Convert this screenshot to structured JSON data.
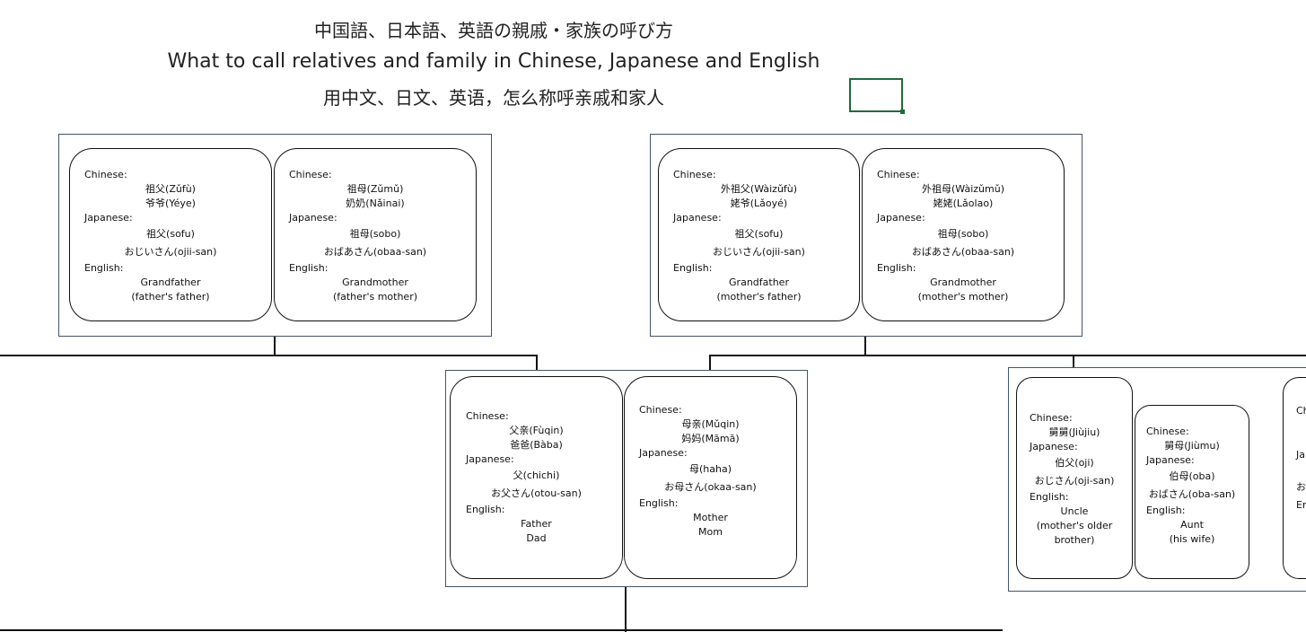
{
  "title": {
    "line1": "中国語、日本語、英語の親戚・家族の呼び方",
    "line2": "What to call relatives and family in Chinese, Japanese and English",
    "line3": "用中文、日文、英语，怎么称呼亲戚和家人"
  },
  "labels": {
    "chinese": "Chinese:",
    "japanese": "Japanese:",
    "english": "English:"
  },
  "cards": {
    "pgf": {
      "zh": [
        "祖父(Zǔfù)",
        "爷爷(Yéye)"
      ],
      "ja": [
        "祖父(sofu)",
        "おじいさん(ojii-san)"
      ],
      "en": [
        "Grandfather",
        "(father's father)"
      ]
    },
    "pgm": {
      "zh": [
        "祖母(Zǔmǔ)",
        "奶奶(Nǎinai)"
      ],
      "ja": [
        "祖母(sobo)",
        "おばあさん(obaa-san)"
      ],
      "en": [
        "Grandmother",
        "(father's mother)"
      ]
    },
    "mgf": {
      "zh": [
        "外祖父(Wàizǔfù)",
        "姥爷(Lǎoyé)"
      ],
      "ja": [
        "祖父(sofu)",
        "おじいさん(ojii-san)"
      ],
      "en": [
        "Grandfather",
        "(mother's father)"
      ]
    },
    "mgm": {
      "zh": [
        "外祖母(Wàizǔmǔ)",
        "姥姥(Lǎolao)"
      ],
      "ja": [
        "祖母(sobo)",
        "おばあさん(obaa-san)"
      ],
      "en": [
        "Grandmother",
        "(mother's mother)"
      ]
    },
    "father": {
      "zh": [
        "父亲(Fùqin)",
        "爸爸(Bàba)"
      ],
      "ja": [
        "父(chichi)",
        "お父さん(otou-san)"
      ],
      "en": [
        "Father",
        "Dad"
      ]
    },
    "mother": {
      "zh": [
        "母亲(Mǔqin)",
        "妈妈(Māmā)"
      ],
      "ja": [
        "母(haha)",
        "お母さん(okaa-san)"
      ],
      "en": [
        "Mother",
        "Mom"
      ]
    },
    "uncle": {
      "zh": [
        "舅舅(Jiùjiu)"
      ],
      "ja": [
        "伯父(oji)",
        "おじさん(oji-san)"
      ],
      "en": [
        "Uncle",
        "(mother's older",
        "brother)"
      ]
    },
    "aunt": {
      "zh": [
        "舅母(Jiùmu)"
      ],
      "ja": [
        "伯母(oba)",
        "おばさん(oba-san)"
      ],
      "en": [
        "Aunt",
        "(his wife)"
      ]
    },
    "partial": {
      "zh_label": "Ch",
      "ja_label": "Ja",
      "ja_partial": "お",
      "en_label": "En"
    }
  }
}
